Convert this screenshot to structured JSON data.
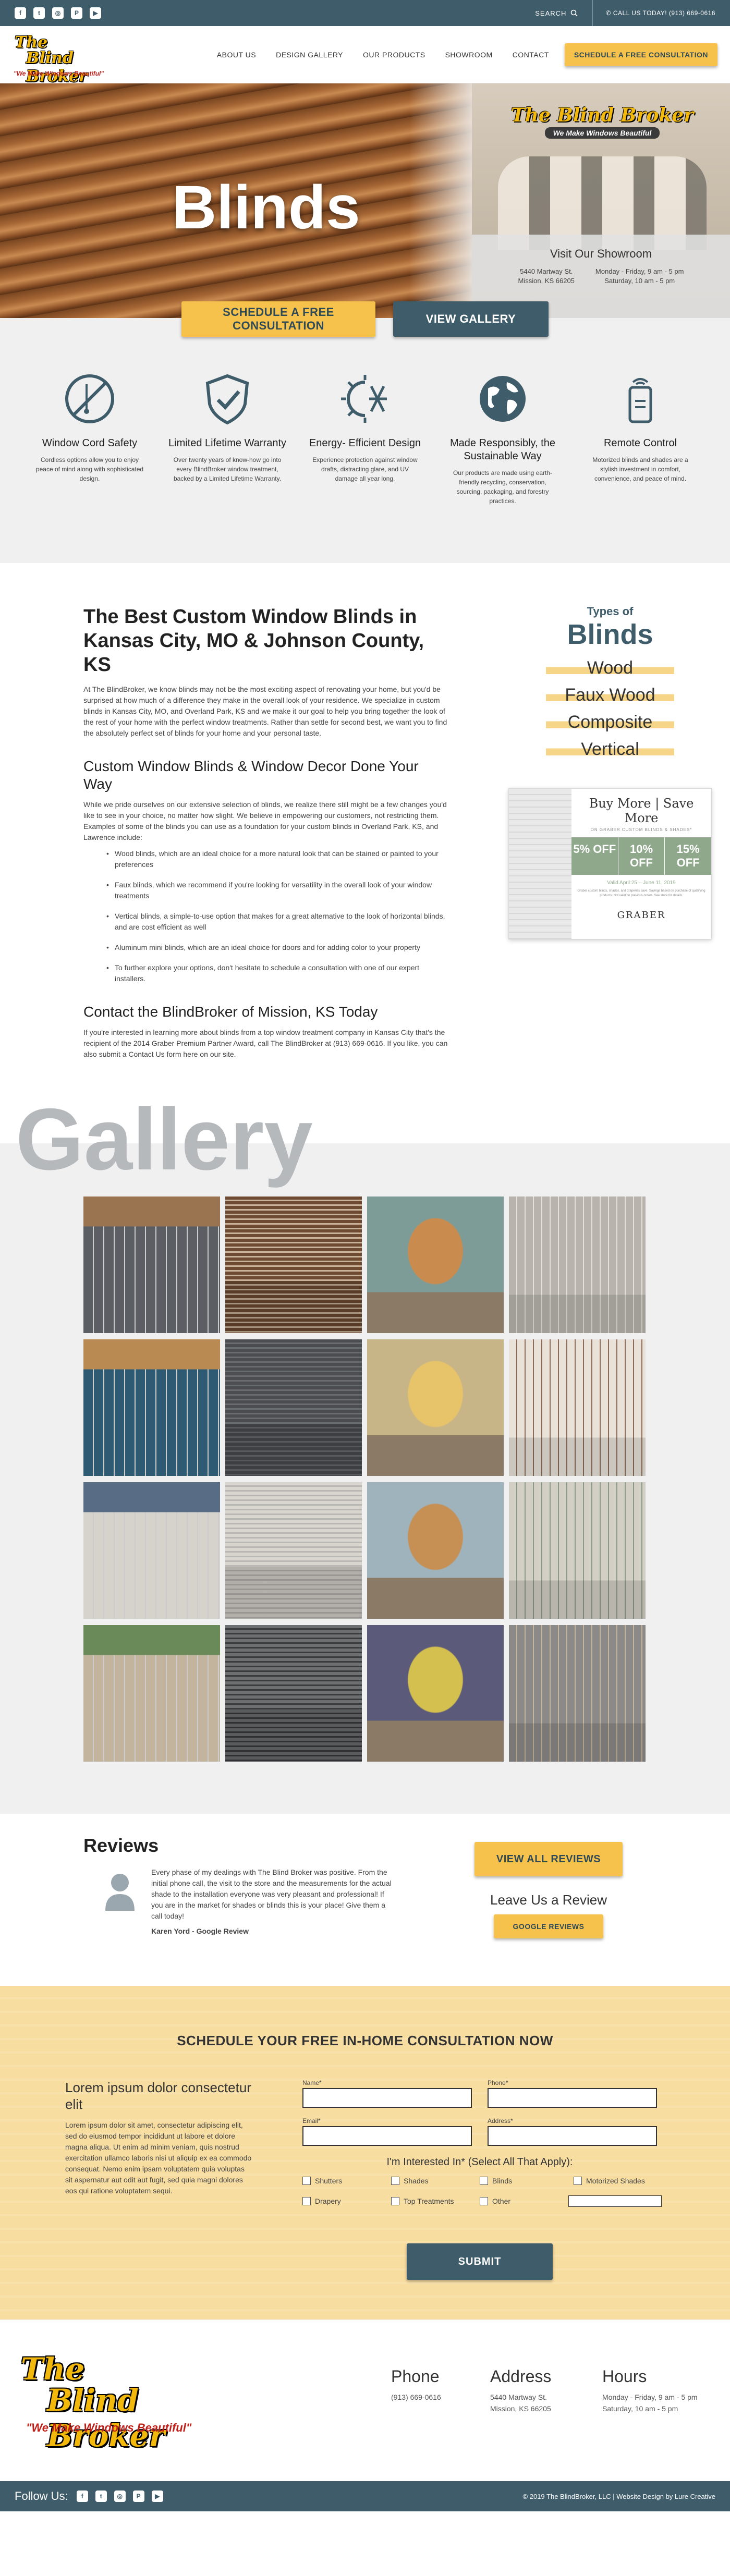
{
  "topbar": {
    "socials": [
      {
        "icon": "facebook-icon",
        "glyph": "f"
      },
      {
        "icon": "twitter-icon",
        "glyph": "t"
      },
      {
        "icon": "instagram-icon",
        "glyph": "◎"
      },
      {
        "icon": "pinterest-icon",
        "glyph": "P"
      },
      {
        "icon": "youtube-icon",
        "glyph": "▶"
      }
    ],
    "search_label": "SEARCH",
    "call_text": "CALL US TODAY! (913) 669-0616"
  },
  "header": {
    "logo_line1": "The",
    "logo_line2": "Blind Broker",
    "logo_tagline": "\"We Make Windows Beautiful\"",
    "nav": [
      "ABOUT US",
      "DESIGN GALLERY",
      "OUR PRODUCTS",
      "SHOWROOM",
      "CONTACT"
    ],
    "cta": "SCHEDULE A FREE CONSULTATION"
  },
  "hero": {
    "title": "Blinds",
    "store_sign": "The Blind Broker",
    "store_tagline": "We Make Windows Beautiful",
    "showroom_title": "Visit Our Showroom",
    "address_line1": "5440 Martway St.",
    "address_line2": "Mission, KS 66205",
    "hours_line1": "Monday - Friday, 9 am - 5 pm",
    "hours_line2": "Saturday, 10 am - 5 pm",
    "btn_consult": "SCHEDULE A FREE CONSULTATION",
    "btn_gallery": "VIEW GALLERY"
  },
  "features": [
    {
      "icon": "no-cord-icon",
      "title": "Window Cord Safety",
      "text": "Cordless options allow you to enjoy peace of mind along with sophisticated design."
    },
    {
      "icon": "shield-check-icon",
      "title": "Limited Lifetime Warranty",
      "text": "Over twenty years of know-how go into every BlindBroker window treatment, backed by a Limited Lifetime Warranty."
    },
    {
      "icon": "sun-snowflake-icon",
      "title": "Energy- Efficient Design",
      "text": "Experience protection against window drafts, distracting glare, and UV damage all year long."
    },
    {
      "icon": "globe-icon",
      "title": "Made Responsibly, the Sustainable Way",
      "text": "Our products are made using earth-friendly recycling, conservation, sourcing, packaging, and forestry practices."
    },
    {
      "icon": "remote-control-icon",
      "title": "Remote Control",
      "text": "Motorized blinds and shades are a stylish investment in comfort, convenience, and peace of mind."
    }
  ],
  "main": {
    "h1": "The Best Custom Window Blinds in Kansas City, MO & Johnson County, KS",
    "p1": "At The BlindBroker, we know blinds may not be the most exciting aspect of renovating your home, but you'd be surprised at how much of a difference they make in the overall look of your residence. We specialize in custom blinds in Kansas City, MO, and Overland Park, KS and we make it our goal to help you bring together the look of the rest of your home with the perfect window treatments. Rather than settle for second best, we want you to find the absolutely perfect set of blinds for your home and your personal taste.",
    "h2": "Custom Window Blinds & Window Decor Done Your Way",
    "p2": "While we pride ourselves on our extensive selection of blinds, we realize there still might be a few changes you'd like to see in your choice, no matter how slight. We believe in empowering our customers, not restricting them. Examples of some of the blinds you can use as a foundation for your custom blinds in Overland Park, KS, and Lawrence include:",
    "list": [
      "Wood blinds, which are an ideal choice for a more natural look that can be stained or painted to your preferences",
      "Faux blinds, which we recommend if you're looking for versatility in the overall look of your window treatments",
      "Vertical blinds, a simple-to-use option that makes for a great alternative to the look of horizontal blinds, and are cost efficient as well",
      "Aluminum mini blinds, which are an ideal choice for doors and for adding color to your property",
      "To further explore your options, don't hesitate to schedule a consultation with one of our expert installers."
    ],
    "h3": "Contact the BlindBroker of Mission, KS Today",
    "p3": "If you're interested in learning more about blinds from a top window treatment company in Kansas City that's the recipient of the 2014 Graber Premium Partner Award, call The BlindBroker at (913) 669-0616. If you like, you can also submit a Contact Us form here on our site."
  },
  "types": {
    "label": "Types of",
    "title": "Blinds",
    "items": [
      "Wood",
      "Faux Wood",
      "Composite",
      "Vertical"
    ]
  },
  "promo": {
    "heading": "Buy More | Save More",
    "sub": "ON GRABER CUSTOM BLINDS & SHADES*",
    "tiers": [
      "5% OFF",
      "10% OFF",
      "15% OFF"
    ],
    "date": "Valid April 25 – June 11, 2019",
    "fine": "Graber custom blinds, shades, and draperies save. Savings based on purchase of qualifying products. Not valid on previous orders. See store for details.",
    "brand": "GRABER"
  },
  "gallery": {
    "title": "Gallery",
    "images": [
      {
        "name": "gallery-image-dark-shades-living-room",
        "bg": "#5b5e63",
        "accent": "#9a7450"
      },
      {
        "name": "gallery-image-wood-blinds-sitting-room",
        "bg": "#c9b29a",
        "accent": "#6e4a32"
      },
      {
        "name": "gallery-image-arched-window-bedroom",
        "bg": "#7d9c98",
        "accent": "#c98c4e"
      },
      {
        "name": "gallery-image-sheer-shades-white-room",
        "bg": "#e4e1dc",
        "accent": "#b8b4ad"
      },
      {
        "name": "gallery-image-wood-blinds-blue-wall",
        "bg": "#2f5a74",
        "accent": "#b98a52"
      },
      {
        "name": "gallery-image-gray-vertical-blinds",
        "bg": "#6a6d70",
        "accent": "#4b4d50"
      },
      {
        "name": "gallery-image-yellow-panel-track",
        "bg": "#c8b587",
        "accent": "#e7c36a"
      },
      {
        "name": "gallery-image-dining-room-shutters",
        "bg": "#8a6c58",
        "accent": "#e8e2d8"
      },
      {
        "name": "gallery-image-white-vertical-dining",
        "bg": "#d6d3cc",
        "accent": "#586d85"
      },
      {
        "name": "gallery-image-vertical-blinds-bedroom",
        "bg": "#b9b7b3",
        "accent": "#d9d6d0"
      },
      {
        "name": "gallery-image-sliding-door-vertical",
        "bg": "#9fb3bd",
        "accent": "#c68f53"
      },
      {
        "name": "gallery-image-sage-living-room",
        "bg": "#8d9a86",
        "accent": "#d2cfc4"
      },
      {
        "name": "gallery-image-tall-sheer-vertical",
        "bg": "#c2b49d",
        "accent": "#6a8a59"
      },
      {
        "name": "gallery-image-black-vertical-blinds",
        "bg": "#3a3b3d",
        "accent": "#6e6f71"
      },
      {
        "name": "gallery-image-purple-accent-room",
        "bg": "#5b5a7a",
        "accent": "#d4c04e"
      },
      {
        "name": "gallery-image-neutral-bedroom",
        "bg": "#c7b59b",
        "accent": "#8c8a88"
      }
    ]
  },
  "reviews": {
    "title": "Reviews",
    "text": "Every phase of my dealings with The Blind Broker was positive. From the initial phone call, the visit to the store and the measurements for the actual shade to the installation everyone was very pleasant and professional! If you are in the market for shades or blinds this is your place! Give them a call today!",
    "author": "Karen Yord - Google Review",
    "view_all": "VIEW ALL REVIEWS",
    "leave": "Leave Us a Review",
    "google": "GOOGLE REVIEWS"
  },
  "consult": {
    "title": "SCHEDULE YOUR FREE IN-HOME CONSULTATION NOW",
    "left_title": "Lorem ipsum dolor consectetur elit",
    "left_text": "Lorem ipsum dolor sit amet, consectetur adipiscing elit, sed do eiusmod tempor incididunt ut labore et dolore magna aliqua. Ut enim ad minim veniam, quis nostrud exercitation ullamco laboris nisi ut aliquip ex ea commodo consequat. Nemo enim ipsam voluptatem quia voluptas sit aspernatur aut odit aut fugit, sed quia magni dolores eos qui ratione voluptatem sequi.",
    "name_label": "Name*",
    "phone_label": "Phone*",
    "email_label": "Email*",
    "address_label": "Address*",
    "interest": "I'm Interested In* (Select All That Apply):",
    "options": [
      "Shutters",
      "Shades",
      "Blinds",
      "Motorized Shades",
      "Drapery",
      "Top Treatments",
      "Other"
    ],
    "submit": "SUBMIT"
  },
  "footer": {
    "phone_title": "Phone",
    "phone": "(913) 669-0616",
    "addr_title": "Address",
    "addr1": "5440 Martway St.",
    "addr2": "Mission, KS 66205",
    "hours_title": "Hours",
    "hours1": "Monday - Friday, 9 am - 5 pm",
    "hours2": "Saturday, 10 am - 5 pm",
    "follow": "Follow Us:",
    "copyright": "© 2019 The BlindBroker, LLC | Website Design by Lure Creative"
  },
  "colors": {
    "primary": "#3f5c6a",
    "accent_yellow": "#f6c24b",
    "form_bg": "#f8dda0",
    "logo_yellow": "#f2b90c",
    "logo_red": "#c0201a"
  }
}
